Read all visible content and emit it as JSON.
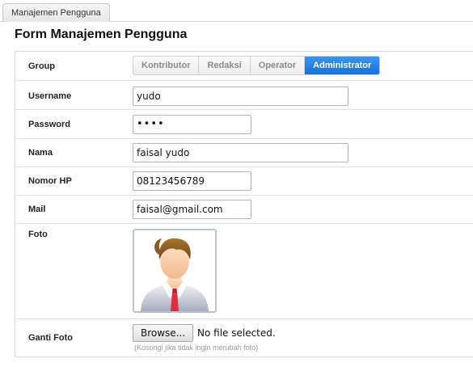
{
  "tab": {
    "label": "Manajemen Pengguna"
  },
  "page_title": "Form Manajemen Pengguna",
  "form": {
    "group": {
      "label": "Group",
      "options": [
        "Kontributor",
        "Redaksi",
        "Operator",
        "Administrator"
      ],
      "selected": "Administrator"
    },
    "username": {
      "label": "Username",
      "value": "yudo"
    },
    "password": {
      "label": "Password",
      "value": "••••"
    },
    "nama": {
      "label": "Nama",
      "value": "faisal yudo"
    },
    "nomor_hp": {
      "label": "Nomor HP",
      "value": "08123456789"
    },
    "mail": {
      "label": "Mail",
      "value": "faisal@gmail.com"
    },
    "foto": {
      "label": "Foto",
      "avatar_icon": "default-user-avatar"
    },
    "ganti_foto": {
      "label": "Ganti Foto",
      "browse_label": "Browse...",
      "status": "No file selected.",
      "hint": "(Kosongi jika tidak ingin merubah foto)"
    }
  },
  "colors": {
    "accent": "#1f7ee0",
    "border": "#d9d9d9",
    "muted_text": "#9a9a9a"
  }
}
